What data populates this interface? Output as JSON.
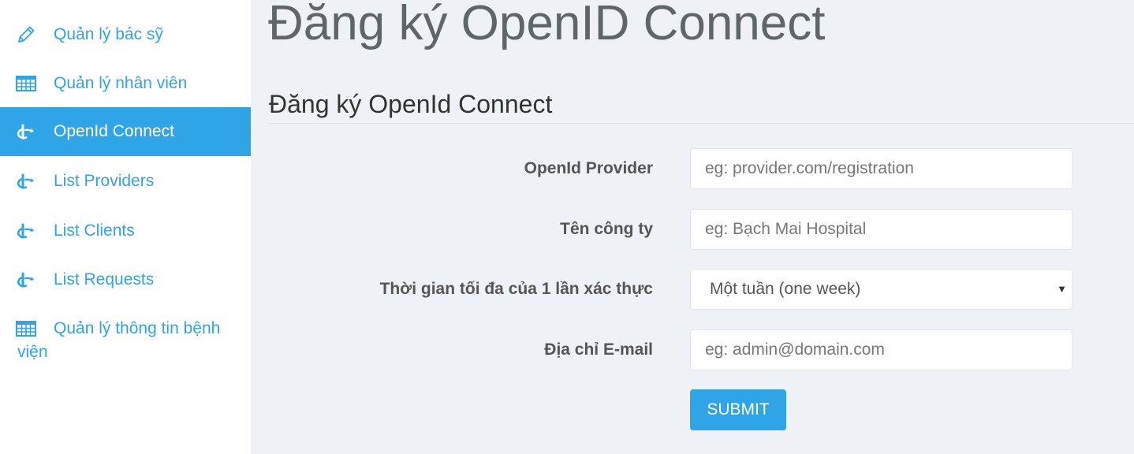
{
  "sidebar": {
    "items": [
      {
        "label": "Quản lý bác sỹ",
        "icon": "pencil-icon",
        "active": false
      },
      {
        "label": "Quản lý nhân viên",
        "icon": "table-icon",
        "active": false
      },
      {
        "label": "OpenId Connect",
        "icon": "openid-icon",
        "active": true
      },
      {
        "label": "List Providers",
        "icon": "openid-icon",
        "active": false
      },
      {
        "label": "List Clients",
        "icon": "openid-icon",
        "active": false
      },
      {
        "label": "List Requests",
        "icon": "openid-icon",
        "active": false
      },
      {
        "label": "Quản lý thông tin bệnh viện",
        "icon": "table-icon",
        "active": false
      }
    ]
  },
  "page": {
    "title": "Đăng ký OpenID Connect",
    "section_title": "Đăng ký OpenId Connect"
  },
  "form": {
    "provider": {
      "label": "OpenId Provider",
      "placeholder": "eg: provider.com/registration",
      "value": ""
    },
    "company": {
      "label": "Tên công ty",
      "placeholder": "eg: Bạch Mai Hospital",
      "value": ""
    },
    "auth_duration": {
      "label": "Thời gian tối đa của 1 lần xác thực",
      "selected": "Một tuần (one week)"
    },
    "email": {
      "label": "Địa chỉ E-mail",
      "placeholder": "eg: admin@domain.com",
      "value": ""
    },
    "submit_label": "SUBMIT"
  },
  "colors": {
    "accent": "#2fa4e7",
    "background": "#eef2f6",
    "title": "#5e656b"
  }
}
